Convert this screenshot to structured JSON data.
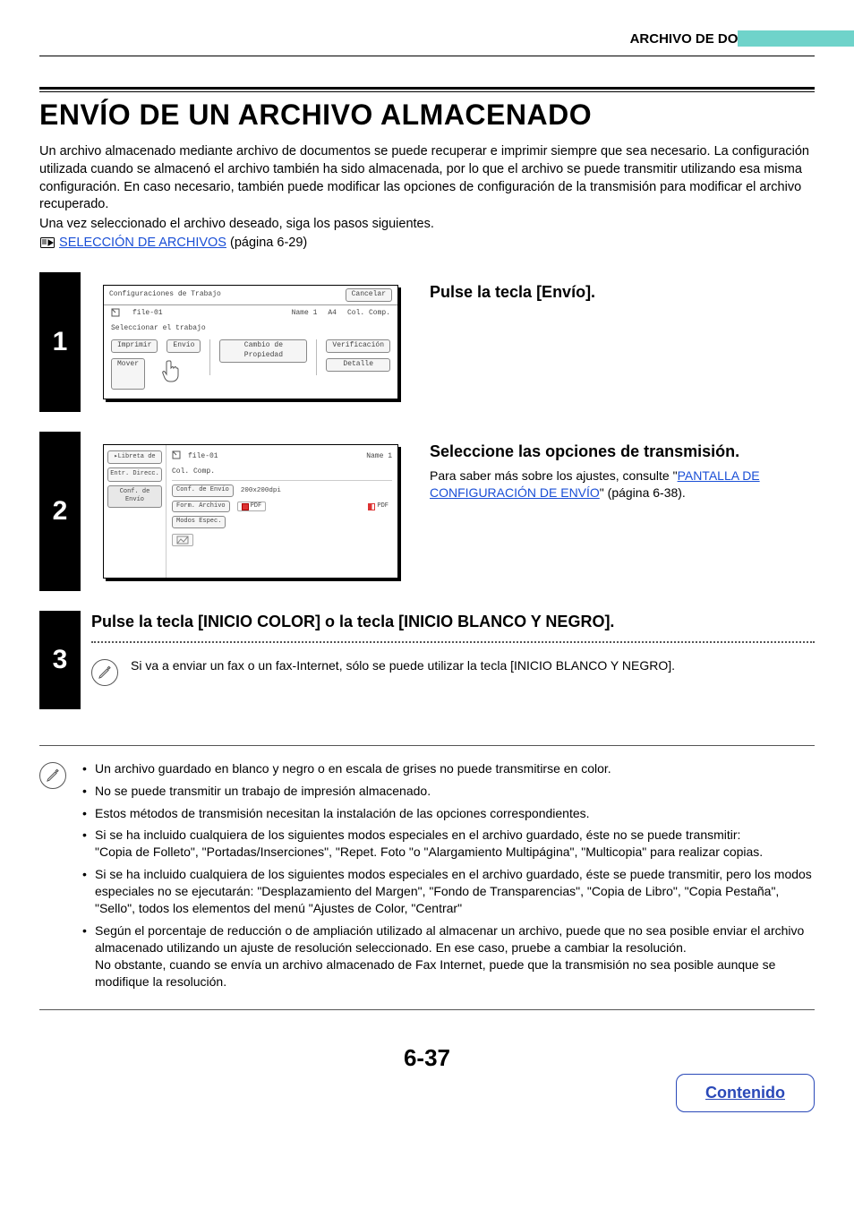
{
  "header": {
    "section": "ARCHIVO DE DOCUMENTOS"
  },
  "title": "ENVÍO DE UN ARCHIVO ALMACENADO",
  "intro": {
    "p1": "Un archivo almacenado mediante archivo de documentos se puede recuperar e imprimir siempre que sea necesario. La configuración utilizada cuando se almacenó el archivo también ha sido almacenada, por lo que el archivo se puede transmitir utilizando esa misma configuración. En caso necesario, también puede modificar las opciones de configuración de la transmisión para modificar el archivo recuperado.",
    "p2": "Una vez seleccionado el archivo deseado, siga los pasos siguientes.",
    "ref_link": "SELECCIÓN DE ARCHIVOS",
    "ref_tail": " (página 6-29)"
  },
  "steps": {
    "s1": {
      "num": "1",
      "heading": "Pulse la tecla [Envío].",
      "mockup": {
        "title": "Configuraciones de Trabajo",
        "cancel": "Cancelar",
        "file": "file-01",
        "name": "Name 1",
        "size": "A4",
        "mode": "Col. Comp.",
        "subtitle": "Seleccionar el trabajo",
        "btn_print": "Imprimir",
        "btn_send": "Envío",
        "btn_prop": "Cambio de Propiedad",
        "btn_verify": "Verificación",
        "btn_move": "Mover",
        "btn_detail": "Detalle"
      }
    },
    "s2": {
      "num": "2",
      "heading": "Seleccione las opciones de transmisión.",
      "text_pre": "Para saber más sobre los ajustes, consulte \"",
      "link": "PANTALLA DE CONFIGURACIÓN DE ENVÍO",
      "text_post": "\" (página  6-38).",
      "mockup": {
        "side_addr": "Libreta de",
        "side_entr": "Entr. Direcc.",
        "side_conf": "Conf. de Envío",
        "file": "file-01",
        "name": "Name 1",
        "mode": "Col. Comp.",
        "conf_envio": "Conf. de Envío",
        "dpi": "200x200dpi",
        "form_archivo": "Form. Archivo",
        "pdf1": "PDF",
        "pdf2": "PDF",
        "modos": "Modos Espec."
      }
    },
    "s3": {
      "num": "3",
      "heading": "Pulse la tecla [INICIO COLOR] o la tecla [INICIO BLANCO Y NEGRO].",
      "hint": "Si va a enviar un fax o un fax-Internet, sólo se puede utilizar la tecla [INICIO BLANCO Y NEGRO]."
    }
  },
  "notes": {
    "n1": "Un archivo guardado en blanco y negro o en escala de grises no puede transmitirse en color.",
    "n2": "No se puede transmitir un trabajo de impresión almacenado.",
    "n3": "Estos métodos de transmisión necesitan la instalación de las opciones correspondientes.",
    "n4a": "Si se ha incluido cualquiera de los siguientes modos especiales en el archivo guardado, éste no se puede transmitir:",
    "n4b": "\"Copia de Folleto\", \"Portadas/Inserciones\", \"Repet. Foto \"o \"Alargamiento Multipágina\", \"Multicopia\" para realizar copias.",
    "n5a": "Si se ha incluido cualquiera de los siguientes modos especiales en el archivo guardado, éste se puede transmitir, pero los modos especiales no se ejecutarán: \"Desplazamiento del Margen\", \"Fondo de Transparencias\", \"Copia de Libro\", \"Copia Pestaña\", \"Sello\", todos los elementos del menú \"Ajustes de Color, \"Centrar\"",
    "n6a": "Según el porcentaje de reducción o de ampliación utilizado al almacenar un archivo, puede que no sea posible enviar el archivo almacenado utilizando un ajuste de resolución seleccionado. En ese caso, pruebe a cambiar la resolución.",
    "n6b": "No obstante, cuando se envía un archivo almacenado de Fax Internet, puede que la transmisión no sea posible aunque se modifique la resolución."
  },
  "footer": {
    "page": "6-37",
    "toc": "Contenido"
  }
}
